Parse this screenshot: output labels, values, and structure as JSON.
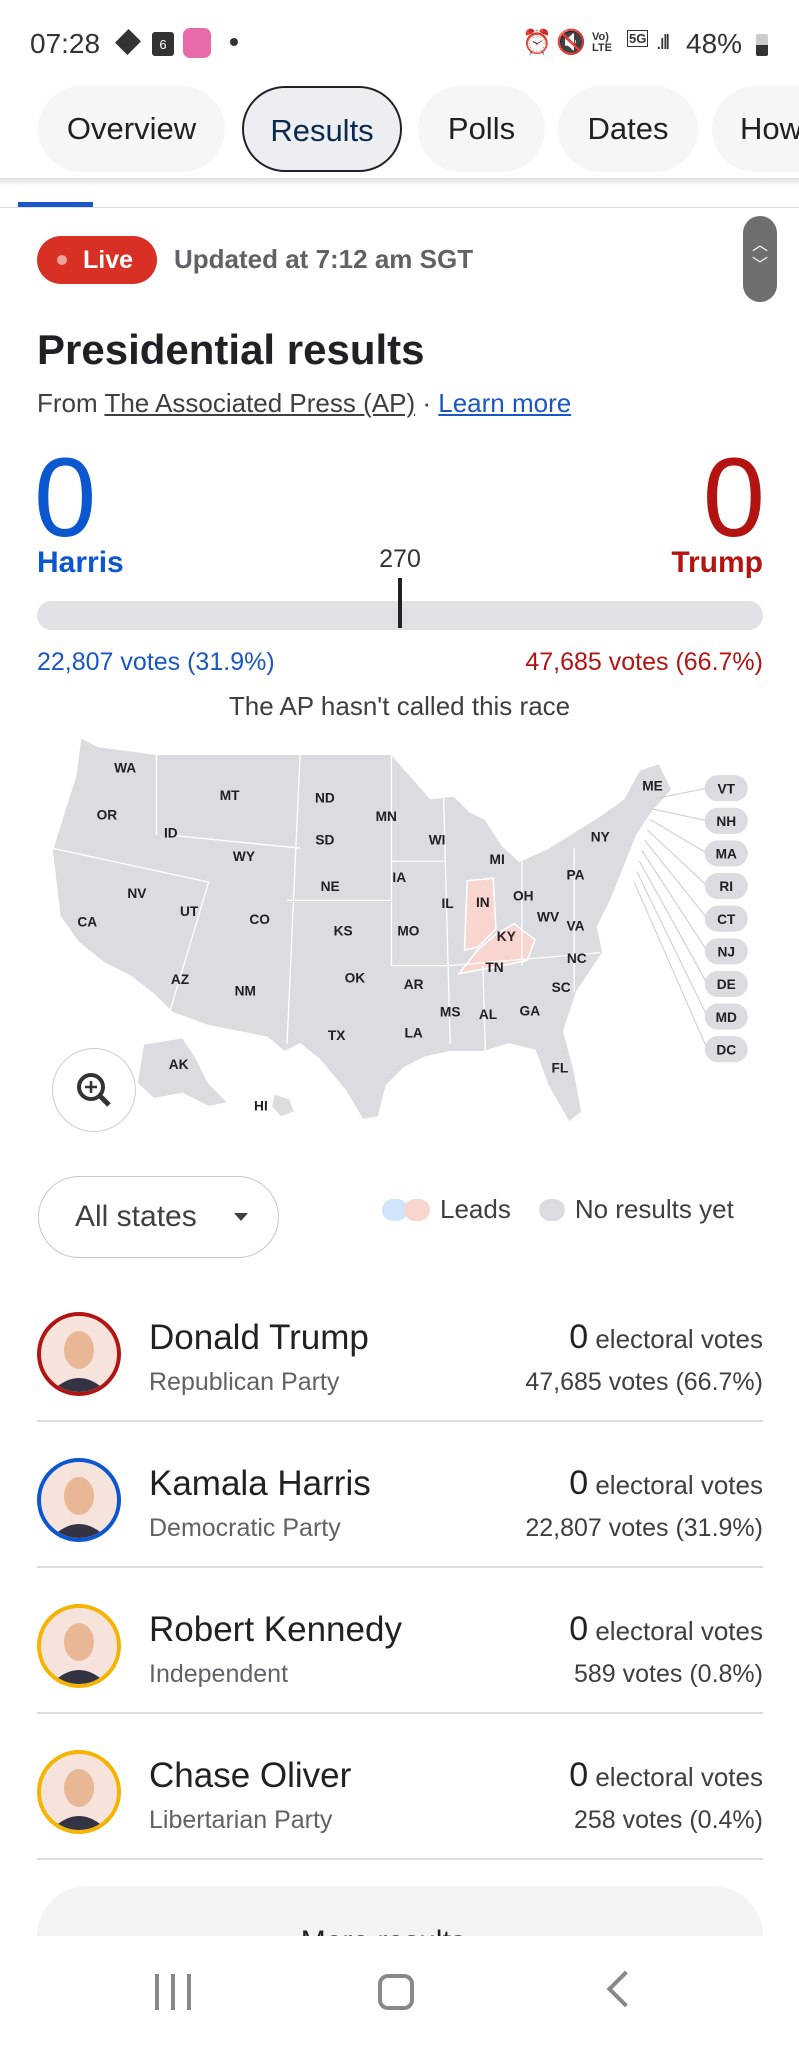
{
  "status_bar": {
    "time": "07:28",
    "calendar_day": "6",
    "battery": "48%",
    "network": "5G"
  },
  "tabs": [
    {
      "label": "Overview"
    },
    {
      "label": "Results",
      "active": true
    },
    {
      "label": "Polls"
    },
    {
      "label": "Dates"
    },
    {
      "label": "How"
    }
  ],
  "live": {
    "badge": "Live",
    "updated": "Updated at 7:12 am SGT"
  },
  "header": {
    "title": "Presidential results",
    "from": "From",
    "source": "The Associated Press (AP)",
    "separator": "·",
    "learn_more": "Learn more"
  },
  "tally": {
    "harris": {
      "electoral": "0",
      "label": "Harris",
      "votes": "22,807 votes (31.9%)"
    },
    "trump": {
      "electoral": "0",
      "label": "Trump",
      "votes": "47,685 votes (66.7%)"
    },
    "threshold": "270",
    "status": "The AP hasn't called this race"
  },
  "map": {
    "states": [
      "WA",
      "MT",
      "ND",
      "MN",
      "OR",
      "ID",
      "SD",
      "WI",
      "WY",
      "MI",
      "NY",
      "ME",
      "PA",
      "IA",
      "NE",
      "NV",
      "UT",
      "CO",
      "IL",
      "IN",
      "OH",
      "WV",
      "VA",
      "CA",
      "KS",
      "MO",
      "KY",
      "TN",
      "NC",
      "OK",
      "AR",
      "SC",
      "AZ",
      "NM",
      "MS",
      "AL",
      "GA",
      "TX",
      "LA",
      "FL",
      "AK",
      "HI"
    ],
    "small_states": [
      "VT",
      "NH",
      "MA",
      "RI",
      "CT",
      "NJ",
      "DE",
      "MD",
      "DC"
    ],
    "leading_red": [
      "IN",
      "KY"
    ],
    "colors": {
      "no_results": "#dadce0",
      "lead_red": "#f9d5cf",
      "lead_blue": "#d2e3fc",
      "harris": "#0b57d0",
      "trump": "#b31412"
    }
  },
  "filter": {
    "selected": "All states"
  },
  "legend": {
    "leads": "Leads",
    "no_results": "No results yet"
  },
  "candidates": [
    {
      "name": "Donald Trump",
      "party": "Republican Party",
      "electoral": "0",
      "ev_label": "electoral votes",
      "votes": "47,685 votes (66.7%)",
      "color": "#b31412"
    },
    {
      "name": "Kamala Harris",
      "party": "Democratic Party",
      "electoral": "0",
      "ev_label": "electoral votes",
      "votes": "22,807 votes (31.9%)",
      "color": "#0b57d0"
    },
    {
      "name": "Robert Kennedy",
      "party": "Independent",
      "electoral": "0",
      "ev_label": "electoral votes",
      "votes": "589 votes (0.8%)",
      "color": "#f4b400"
    },
    {
      "name": "Chase Oliver",
      "party": "Libertarian Party",
      "electoral": "0",
      "ev_label": "electoral votes",
      "votes": "258 votes (0.4%)",
      "color": "#f4b400"
    }
  ],
  "more_results": "More results"
}
